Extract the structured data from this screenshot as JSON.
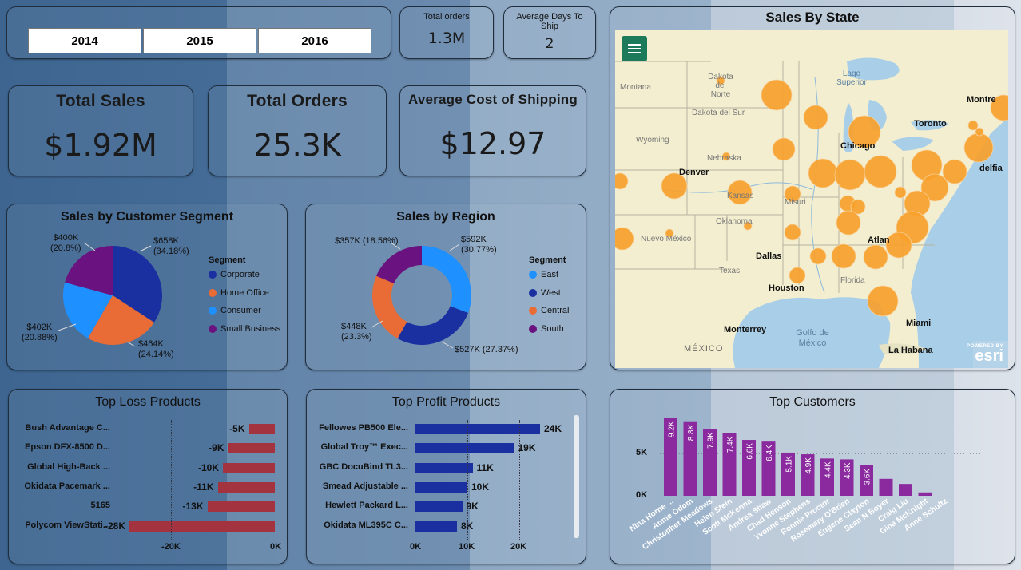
{
  "years": {
    "y2014": "2014",
    "y2015": "2015",
    "y2016": "2016"
  },
  "kpi_small": {
    "total_orders_title": "Total orders",
    "total_orders_value": "1.3M",
    "avg_days_title": "Average Days To Ship",
    "avg_days_value": "2"
  },
  "kpi": {
    "total_sales_title": "Total Sales",
    "total_sales_value": "$1.92M",
    "total_orders_title": "Total Orders",
    "total_orders_value": "25.3K",
    "avg_cost_title": "Average Cost of Shipping",
    "avg_cost_value": "$12.97"
  },
  "segment": {
    "title": "Sales by Customer Segment",
    "legend_title": "Segment",
    "slices": [
      {
        "name": "Corporate",
        "value": 658,
        "label": "$658K",
        "pct": "(34.18%)",
        "color": "#1a2fa0"
      },
      {
        "name": "Home Office",
        "value": 464,
        "label": "$464K",
        "pct": "(24.14%)",
        "color": "#e96b35"
      },
      {
        "name": "Consumer",
        "value": 402,
        "label": "$402K",
        "pct": "(20.88%)",
        "color": "#1e90ff"
      },
      {
        "name": "Small Business",
        "value": 400,
        "label": "$400K",
        "pct": "(20.8%)",
        "color": "#6a1280"
      }
    ]
  },
  "region": {
    "title": "Sales by Region",
    "legend_title": "Segment",
    "slices": [
      {
        "name": "East",
        "value": 592,
        "label": "$592K",
        "pct": "(30.77%)",
        "color": "#1e90ff"
      },
      {
        "name": "West",
        "value": 527,
        "label": "$527K (27.37%)",
        "pct": "",
        "color": "#1a2fa0"
      },
      {
        "name": "Central",
        "value": 448,
        "label": "$448K",
        "pct": "(23.3%)",
        "color": "#e96b35"
      },
      {
        "name": "South",
        "value": 357,
        "label": "$357K (18.56%)",
        "pct": "",
        "color": "#6a1280"
      }
    ]
  },
  "map": {
    "title": "Sales By State",
    "esri_small": "POWERED BY",
    "esri": "esri",
    "places": [
      {
        "name": "Dakota del Norte"
      },
      {
        "name": "Dakota del Sur"
      },
      {
        "name": "Wyoming"
      },
      {
        "name": "Nebraska"
      },
      {
        "name": "Denver"
      },
      {
        "name": "Kansas"
      },
      {
        "name": "Oklahoma"
      },
      {
        "name": "Nuevo México"
      },
      {
        "name": "Texas"
      },
      {
        "name": "Dallas"
      },
      {
        "name": "Houston"
      },
      {
        "name": "Monterrey"
      },
      {
        "name": "MÉXICO"
      },
      {
        "name": "Golfo de México"
      },
      {
        "name": "Miami"
      },
      {
        "name": "La Habana"
      },
      {
        "name": "Chicago"
      },
      {
        "name": "Toronto"
      },
      {
        "name": "Montre"
      },
      {
        "name": "Lago Superior"
      },
      {
        "name": "Montana"
      },
      {
        "name": "Misuri"
      },
      {
        "name": "Atlan"
      },
      {
        "name": "Florida"
      },
      {
        "name": "delfia"
      }
    ]
  },
  "loss": {
    "title": "Top Loss Products",
    "items": [
      {
        "name": "Bush Advantage C...",
        "value": -5,
        "label": "-5K"
      },
      {
        "name": "Epson DFX-8500 D...",
        "value": -9,
        "label": "-9K"
      },
      {
        "name": "Global High-Back ...",
        "value": -10,
        "label": "-10K"
      },
      {
        "name": "Okidata Pacemark ...",
        "value": -11,
        "label": "-11K"
      },
      {
        "name": "5165",
        "value": -13,
        "label": "-13K"
      },
      {
        "name": "Polycom ViewStati...",
        "value": -28,
        "label": "-28K"
      }
    ],
    "ticks": [
      "-20K",
      "0K"
    ],
    "color": "#a3343f"
  },
  "profit": {
    "title": "Top Profit Products",
    "items": [
      {
        "name": "Fellowes PB500 Ele...",
        "value": 24,
        "label": "24K"
      },
      {
        "name": "Global Troy™ Exec...",
        "value": 19,
        "label": "19K"
      },
      {
        "name": "GBC DocuBind TL3...",
        "value": 11,
        "label": "11K"
      },
      {
        "name": "Smead Adjustable ...",
        "value": 10,
        "label": "10K"
      },
      {
        "name": "Hewlett Packard L...",
        "value": 9,
        "label": "9K"
      },
      {
        "name": "Okidata ML395C C...",
        "value": 8,
        "label": "8K"
      }
    ],
    "ticks": [
      "0K",
      "10K",
      "20K"
    ],
    "color": "#1a2fa0"
  },
  "customers": {
    "title": "Top Customers",
    "yticks": [
      "5K",
      "0K"
    ],
    "color": "#8a2a9e",
    "items": [
      {
        "name": "Nina Horne ...",
        "value": 9.2,
        "label": "9.2K"
      },
      {
        "name": "Annie Odom",
        "value": 8.8,
        "label": "8.8K"
      },
      {
        "name": "Christopher Meadows",
        "value": 7.9,
        "label": "7.9K"
      },
      {
        "name": "Helen Stein",
        "value": 7.4,
        "label": "7.4K"
      },
      {
        "name": "Scott McKenna",
        "value": 6.6,
        "label": "6.6K"
      },
      {
        "name": "Andrea Shaw",
        "value": 6.4,
        "label": "6.4K"
      },
      {
        "name": "Chad Henson",
        "value": 5.1,
        "label": "5.1K"
      },
      {
        "name": "Yvonne Stephens",
        "value": 4.9,
        "label": "4.9K"
      },
      {
        "name": "Ronnie Proctor",
        "value": 4.4,
        "label": "4.4K"
      },
      {
        "name": "Rosemary O'Brien",
        "value": 4.3,
        "label": "4.3K"
      },
      {
        "name": "Eugene Clayton",
        "value": 3.6,
        "label": "3.6K"
      },
      {
        "name": "Sean N Boyer",
        "value": 2.0,
        "label": ""
      },
      {
        "name": "Craig Liu",
        "value": 1.4,
        "label": ""
      },
      {
        "name": "Gina McKnight",
        "value": 0.4,
        "label": ""
      },
      {
        "name": "Anne Schultz",
        "value": 0.0,
        "label": ""
      }
    ]
  }
}
